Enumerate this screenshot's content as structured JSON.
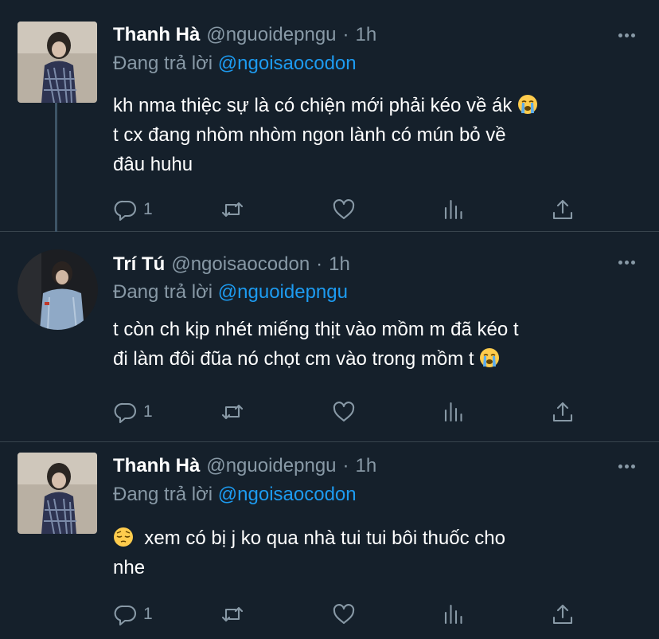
{
  "tweets": [
    {
      "name": "Thanh Hà",
      "handle": "@nguoidepngu",
      "dot": "·",
      "time": "1h",
      "reply_prefix": "Đang trả lời",
      "reply_mention": "@ngoisaocodon",
      "lines": [
        "kh nma thiệc sự là có chiện mới phải kéo về ák",
        "t cx đang nhòm nhòm ngon lành có mún bỏ về",
        "đâu huhu"
      ],
      "emoji": "loudly-crying-face",
      "reply_count": "1"
    },
    {
      "name": "Trí Tú",
      "handle": "@ngoisaocodon",
      "dot": "·",
      "time": "1h",
      "reply_prefix": "Đang trả lời",
      "reply_mention": "@nguoidepngu",
      "lines": [
        "t còn ch kịp nhét miếng thịt vào mồm m đã kéo t",
        "đi làm đôi đũa nó chọt cm vào trong mồm t"
      ],
      "emoji": "loudly-crying-face",
      "reply_count": "1"
    },
    {
      "name": "Thanh Hà",
      "handle": "@nguoidepngu",
      "dot": "·",
      "time": "1h",
      "reply_prefix": "Đang trả lời",
      "reply_mention": "@ngoisaocodon",
      "lines": [
        "xem có bị j ko qua nhà tui tui bôi thuốc cho",
        "nhe"
      ],
      "emoji": "pensive-face",
      "reply_count": "1"
    }
  ],
  "theme": {
    "background": "#15202b",
    "text": "#ffffff",
    "secondary_text": "#8899a6",
    "accent": "#1d9bf0",
    "divider": "#38444d"
  },
  "icons": [
    "reply-icon",
    "retweet-icon",
    "like-icon",
    "analytics-icon",
    "share-icon",
    "more-icon"
  ]
}
